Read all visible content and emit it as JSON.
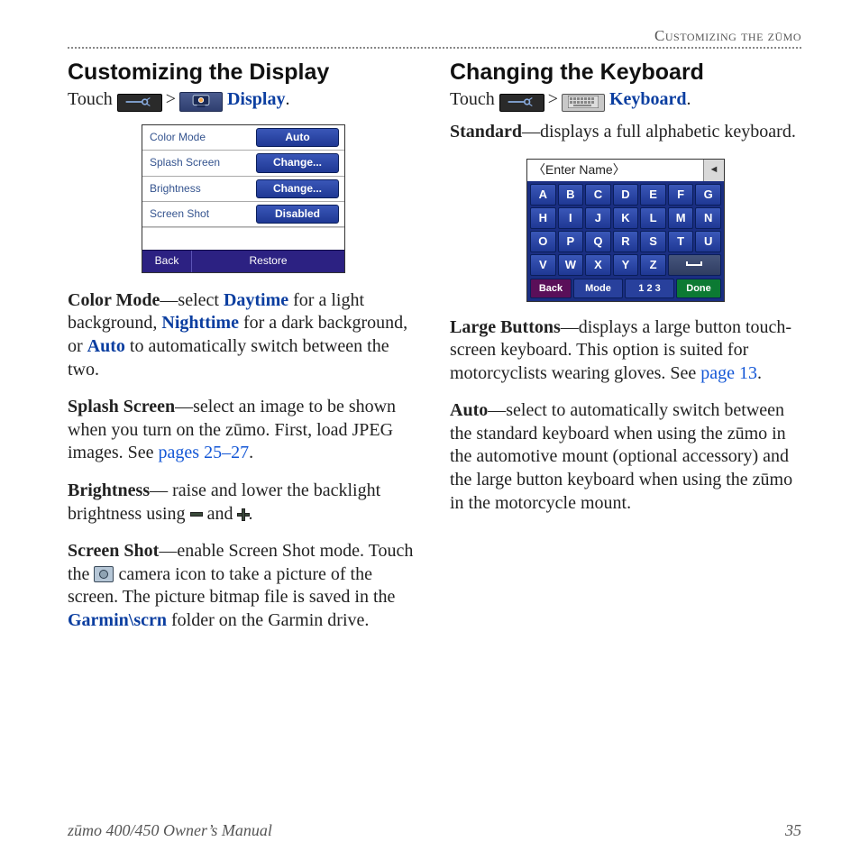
{
  "runningHead": "Customizing the zūmo",
  "left": {
    "heading": "Customizing the Display",
    "touchPrefix": "Touch ",
    "gt": " > ",
    "displayWord": "Display",
    "period": ".",
    "device": {
      "rows": [
        {
          "label": "Color Mode",
          "btn": "Auto"
        },
        {
          "label": "Splash Screen",
          "btn": "Change..."
        },
        {
          "label": "Brightness",
          "btn": "Change..."
        },
        {
          "label": "Screen Shot",
          "btn": "Disabled"
        }
      ],
      "back": "Back",
      "restore": "Restore"
    },
    "p1": {
      "boldLead": "Color Mode",
      "t1": "—select ",
      "day": "Daytime",
      "t2": " for a light background, ",
      "night": "Nighttime",
      "t3": " for a dark background, or ",
      "auto": "Auto",
      "t4": " to automatically switch between the two."
    },
    "p2": {
      "boldLead": "Splash Screen",
      "t1": "—select an image to be shown when you turn on the zūmo. First, load JPEG images. See ",
      "link": "pages 25–27",
      "t2": "."
    },
    "p3": {
      "boldLead": "Brightness",
      "t1": "— raise and lower the backlight brightness using ",
      "and": " and ",
      "end": "."
    },
    "p4": {
      "boldLead": "Screen Shot",
      "t1": "—enable Screen Shot mode. Touch the ",
      "t2": " camera icon to take a picture of the screen. The picture bitmap file is saved in the ",
      "folder": "Garmin\\scrn",
      "t3": " folder on the Garmin drive."
    }
  },
  "right": {
    "heading": "Changing the Keyboard",
    "touchPrefix": "Touch ",
    "gt": " > ",
    "keyboardWord": "Keyboard",
    "period": ".",
    "pStd": {
      "boldLead": "Standard",
      "t1": "—displays a full alphabetic keyboard."
    },
    "device": {
      "prompt": "〈Enter Name〉",
      "bsp": "◄",
      "keys": [
        "A",
        "B",
        "C",
        "D",
        "E",
        "F",
        "G",
        "H",
        "I",
        "J",
        "K",
        "L",
        "M",
        "N",
        "O",
        "P",
        "Q",
        "R",
        "S",
        "T",
        "U",
        "V",
        "W",
        "X",
        "Y",
        "Z"
      ],
      "space": "␣",
      "back": "Back",
      "mode": "Mode",
      "n123": "1 2 3",
      "done": "Done"
    },
    "pLarge": {
      "boldLead": "Large Buttons",
      "t1": "—displays a large button touch-screen keyboard. This option is suited for motorcyclists wearing gloves. See ",
      "link": "page 13",
      "t2": "."
    },
    "pAuto": {
      "boldLead": "Auto",
      "t1": "—select to automatically switch between the standard keyboard when using the zūmo in the automotive mount (optional accessory) and the large button keyboard when using the zūmo in the motorcycle mount."
    }
  },
  "footer": {
    "left": "zūmo 400/450 Owner’s Manual",
    "right": "35"
  }
}
